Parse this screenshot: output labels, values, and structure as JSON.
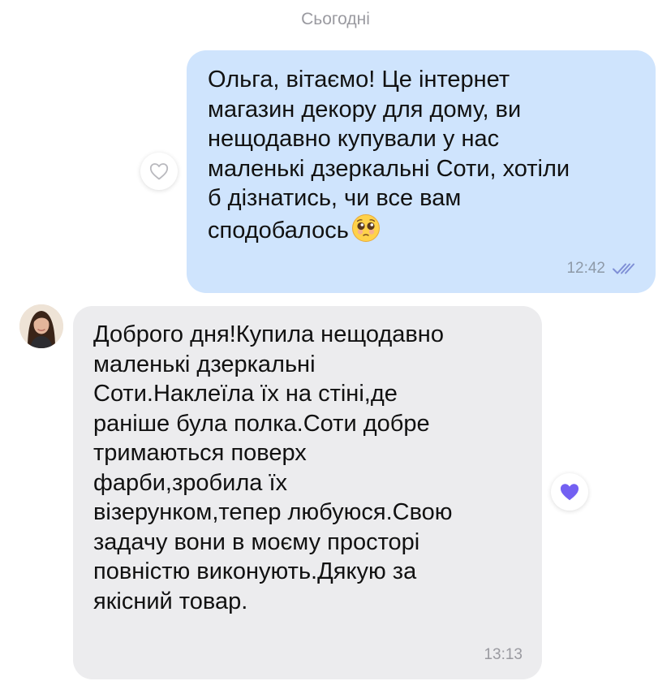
{
  "date_separator": "Сьогодні",
  "messages": [
    {
      "direction": "outgoing",
      "text": "Ольга, вітаємо! Це інтернет\nмагазин декору для дому, ви\nнещодавно купували у нас\nмаленькі дзеркальні Соти, хотіли\nб дізнатись, чи все вам\nсподобалось",
      "emoji": "pleading-face-emoji",
      "time": "12:42",
      "status_icon": "double-check-icon",
      "reaction": "heart-outline-icon"
    },
    {
      "direction": "incoming",
      "text": "Доброго дня!Купила нещодавно\nмаленькі дзеркальні\nСоти.Наклеїла їх на стіні,де\nраніше була полка.Соти добре\nтримаються поверх\nфарби,зробила їх\nвізерунком,тепер любуюся.Свою\nзадачу вони в моєму просторі\nповністю виконують.Дякую за\nякісний товар.",
      "time": "13:13",
      "reaction": "heart-filled-icon",
      "avatar": "avatar"
    }
  ],
  "colors": {
    "outgoing_bubble": "#cfe4fd",
    "incoming_bubble": "#ececee",
    "heart_filled": "#7360f2",
    "ticks": "#7f8fd6"
  }
}
